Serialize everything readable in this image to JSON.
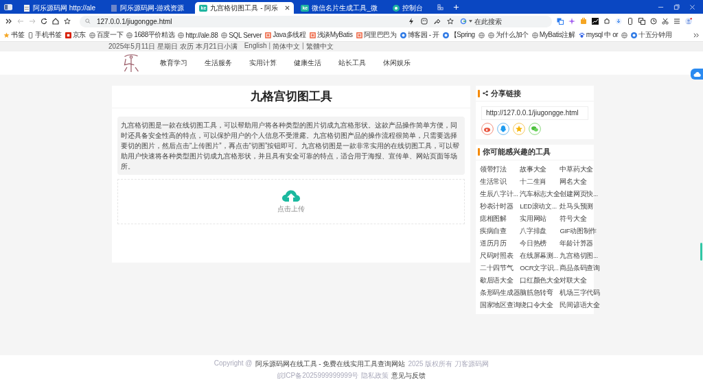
{
  "browser": {
    "tabs": [
      {
        "title": "阿乐源码网 http://ale",
        "kind": "page",
        "selected": false
      },
      {
        "title": "阿乐源码网-游戏资源",
        "kind": "faded",
        "selected": false
      },
      {
        "title": "九宫格切图工具 - 阿乐",
        "kind": "badge",
        "badge": "ke",
        "selected": true
      },
      {
        "title": "微信名片生成工具_微",
        "kind": "badge",
        "badge": "ke",
        "selected": false
      },
      {
        "title": "控制台",
        "kind": "circle",
        "selected": false
      }
    ],
    "address": "127.0.0.1/jiugongge.html",
    "search_placeholder": "在此搜索",
    "bookmarks": [
      {
        "label": "书签",
        "kind": "star"
      },
      {
        "label": "手机书签",
        "kind": "phone"
      },
      {
        "label": "京东",
        "kind": "red"
      },
      {
        "label": "百度一下",
        "kind": "globe"
      },
      {
        "label": "1688平价精选",
        "kind": "globe"
      },
      {
        "label": "http://ale.88",
        "kind": "globe"
      },
      {
        "label": "SQL Server",
        "kind": "globe"
      },
      {
        "label": "Java多线程",
        "kind": "redsoft"
      },
      {
        "label": "浅谈MyBatis",
        "kind": "redsoft"
      },
      {
        "label": "阿里巴巴为",
        "kind": "redsoft"
      },
      {
        "label": "博客园 - 开",
        "kind": "blue"
      },
      {
        "label": "【Spring",
        "kind": "blue"
      },
      {
        "kind": "globe"
      },
      {
        "label": "为什么加个",
        "kind": "globe"
      },
      {
        "label": "MyBatis注解",
        "kind": "globe"
      },
      {
        "label": "mysql 中 or",
        "kind": "paw"
      },
      {
        "kind": "globe"
      },
      {
        "label": "十五分钟用",
        "kind": "blue"
      }
    ]
  },
  "page": {
    "topbar": {
      "date": "2025年5月11日 星期日 农历 本月21日小满",
      "languages": [
        "English",
        "简体中文",
        "繁體中文"
      ],
      "separators": [
        "|",
        "|"
      ]
    },
    "nav": [
      "教育学习",
      "生活服务",
      "实用计算",
      "健康生活",
      "站长工具",
      "休闲娱乐"
    ],
    "tool": {
      "title": "九格宫切图工具",
      "description": "九宫格切图是一款在线切图工具，可以帮助用户将各种类型的图片切成九宫格形状。这款产品操作简单方便，同时还具备安全性高的特点，可以保护用户的个人信息不受泄露。九宫格切图产品的操作流程很简单，只需要选择要切的图片，然后点击“上传图片”，再点击“切图”按钮即可。九宫格切图是一款非常实用的在线切图工具，可以帮助用户快速将各种类型图片切成九宫格形状，并且具有安全可靠的特点，适合用于海报、宣传单、网站页面等场所。",
      "upload_label": "点击上传"
    },
    "share": {
      "title": "分享链接",
      "url": "http://127.0.0.1/jiugongge.html"
    },
    "related": {
      "title": "你可能感兴趣的工具",
      "items": [
        "领带打法",
        "故事大全",
        "中草药大全",
        "生活常识",
        "十二生肖",
        "网名大全",
        "生辰八字计...",
        "汽车标志大全",
        "创建网页快...",
        "秒表计时器",
        "LED滚动文...",
        "灶马头预测",
        "痣相图解",
        "实用网站",
        "符号大全",
        "疾病自查",
        "八字排盘",
        "GIF动图制作",
        "道历月历",
        "今日热榜",
        "年龄计算器",
        "尺码对照表",
        "在线屏幕测...",
        "九宫格切图...",
        "二十四节气",
        "OCR文字识...",
        "商品条码查询",
        "歇后语大全",
        "口红颜色大全",
        "对联大全",
        "条形码生成器",
        "脑筋急转弯",
        "机场三字代码",
        "国家地区查询",
        "绕口令大全",
        "民间谚语大全"
      ]
    },
    "footer": {
      "copyright_prefix": "Copyright @",
      "site_name": "阿乐源码网在线工具 - 免费在线实用工具查询网站",
      "copyright_suffix": "2025 版权所有 刀客源码网",
      "icp": "皖ICP备2025999999999号",
      "privacy": "隐私政策",
      "feedback": "意见与反馈"
    }
  }
}
